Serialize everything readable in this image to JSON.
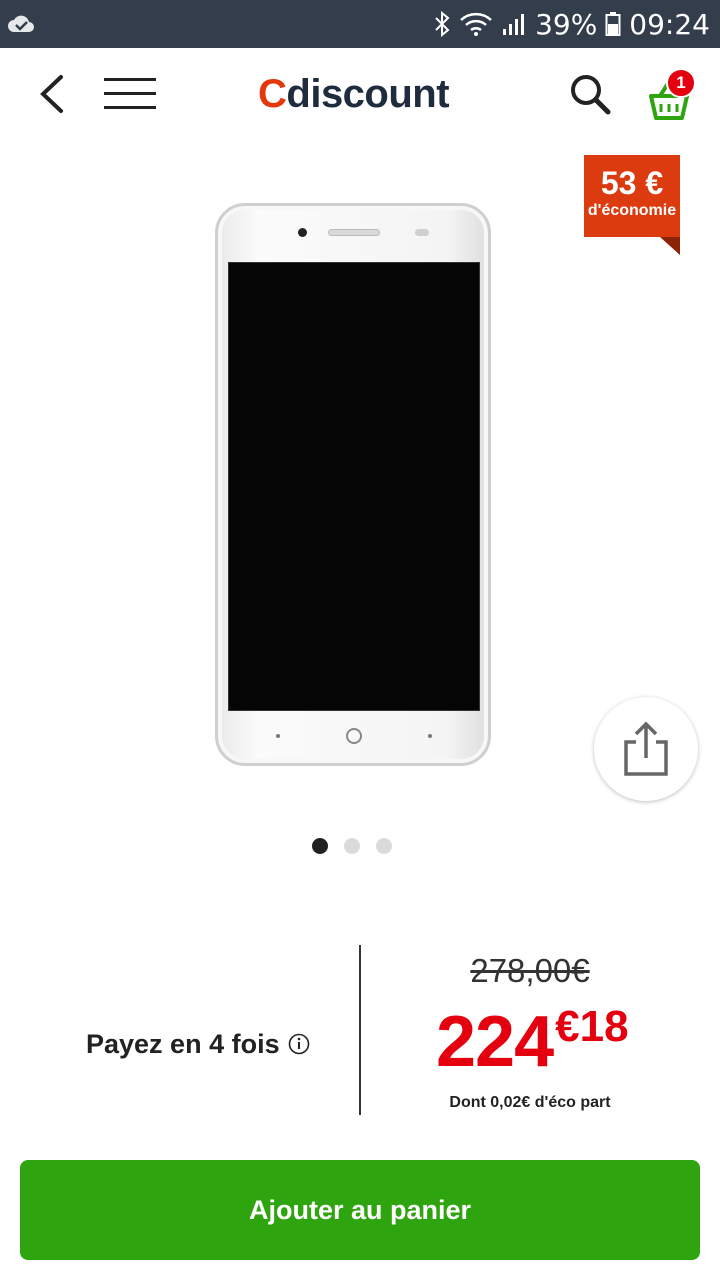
{
  "status_bar": {
    "battery": "39%",
    "time": "09:24",
    "icons": [
      "cloud-check-icon",
      "bluetooth-icon",
      "wifi-icon",
      "signal-icon",
      "battery-icon"
    ]
  },
  "header": {
    "logo_c": "C",
    "logo_rest": "discount",
    "cart_count": "1",
    "icons": [
      "back-arrow-icon",
      "hamburger-menu-icon",
      "search-icon",
      "basket-icon"
    ],
    "accent_color": "#e4380c",
    "cart_color": "#2ea40e"
  },
  "product": {
    "savings_amount": "53 €",
    "savings_label": "d'économie",
    "image_count": 3,
    "active_image": 1,
    "share_icon": "share-icon"
  },
  "pricing": {
    "installments_label": "Payez en 4 fois",
    "old_price": "278,00€",
    "price_int": "224",
    "price_cents": "€18",
    "eco_part": "Dont 0,02€ d'éco part",
    "price_color": "#e4000f"
  },
  "actions": {
    "add_to_cart": "Ajouter au panier",
    "add_to_cart_color": "#2ea40e"
  }
}
